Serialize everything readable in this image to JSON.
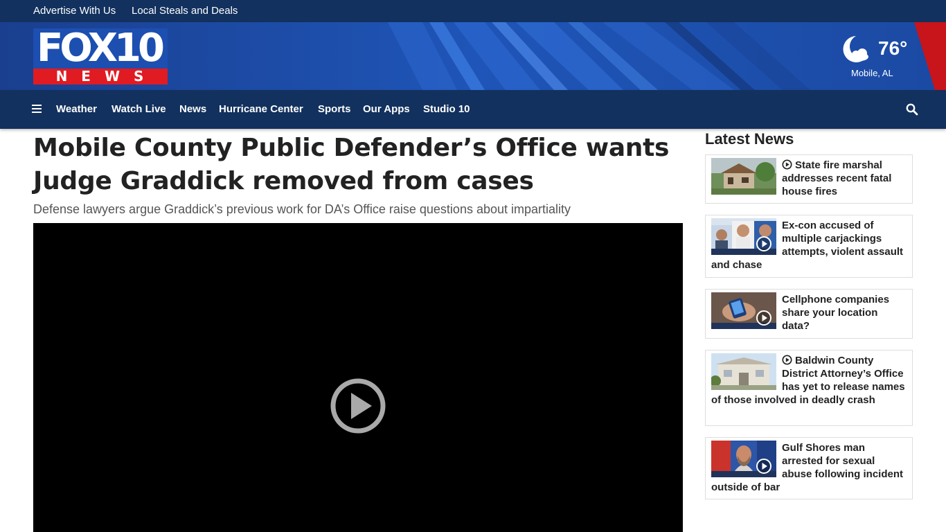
{
  "utility": {
    "links": [
      "Advertise With Us",
      "Local Steals and Deals"
    ]
  },
  "header": {
    "logo_top": "FOX10",
    "logo_bottom": "NEWS",
    "brand_colors": {
      "blue": "#1c4fb0",
      "red": "#e11b22",
      "navy": "#12315e"
    }
  },
  "weather": {
    "icon": "moon-cloud-icon",
    "temperature": "76°",
    "location": "Mobile, AL"
  },
  "nav": {
    "items": [
      "Weather",
      "Watch Live",
      "News",
      "Hurricane Center",
      "Sports",
      "Our Apps",
      "Studio 10"
    ]
  },
  "article": {
    "headline": "Mobile County Public Defender’s Office wants Judge Graddick removed from cases",
    "subhead": "Defense lawyers argue Graddick’s previous work for DA’s Office raise questions about impartiality"
  },
  "sidebar": {
    "title": "Latest News",
    "items": [
      {
        "title": "State fire marshal addresses recent fatal house fires",
        "leading_play_icon": true
      },
      {
        "title": "Ex-con accused of multiple carjackings attempts, violent assault and chase",
        "leading_play_icon": false
      },
      {
        "title": "Cellphone companies share your location data?",
        "leading_play_icon": false
      },
      {
        "title": "Baldwin County District Attorney’s Office has yet to release names of those involved in deadly crash",
        "leading_play_icon": true
      },
      {
        "title": "Gulf Shores man arrested for sexual abuse following incident outside of bar",
        "leading_play_icon": false
      }
    ]
  }
}
